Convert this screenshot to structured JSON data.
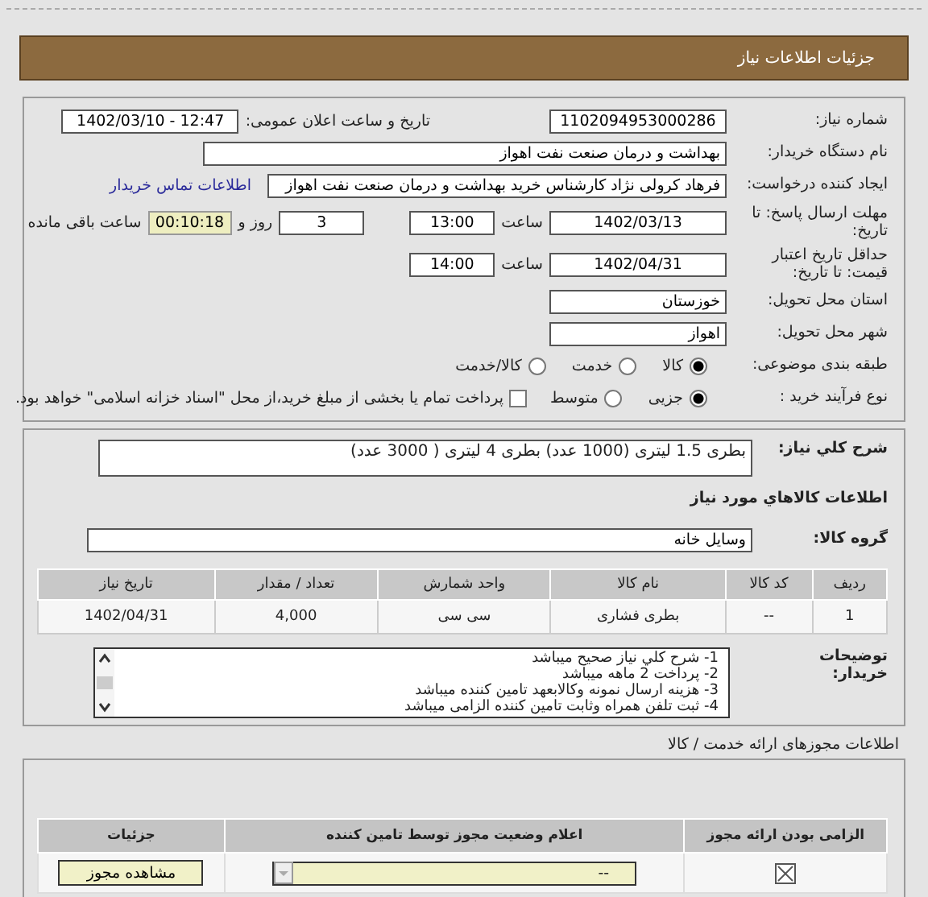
{
  "header": {
    "title": "جزئیات اطلاعات نیاز"
  },
  "details": {
    "need_number": {
      "label": "شماره نیاز:",
      "value": "1102094953000286"
    },
    "announce": {
      "label": "تاریخ و ساعت اعلان عمومی:",
      "value": "1402/03/10 - 12:47"
    },
    "buyer": {
      "label": "نام دستگاه خریدار:",
      "value": "بهداشت و درمان صنعت نفت اهواز"
    },
    "requester": {
      "label": "ایجاد کننده درخواست:",
      "value": "فرهاد کرولی نژاد کارشناس خرید بهداشت و درمان صنعت نفت اهواز",
      "link": "اطلاعات تماس خریدار"
    },
    "deadline": {
      "label": "مهلت ارسال پاسخ: تا تاریخ:",
      "date": "1402/03/13",
      "time_label": "ساعت",
      "time": "13:00",
      "days": "3",
      "days_label": "روز و",
      "remaining": "00:10:18",
      "remaining_label": "ساعت باقی مانده"
    },
    "validity": {
      "label": "حداقل تاریخ اعتبار قیمت: تا تاریخ:",
      "date": "1402/04/31",
      "time_label": "ساعت",
      "time": "14:00"
    },
    "province": {
      "label": "استان محل تحویل:",
      "value": "خوزستان"
    },
    "city": {
      "label": "شهر محل تحویل:",
      "value": "اهواز"
    },
    "category": {
      "label": "طبقه بندی موضوعی:",
      "options": [
        {
          "label": "کالا",
          "selected": true
        },
        {
          "label": "خدمت",
          "selected": false
        },
        {
          "label": "کالا/خدمت",
          "selected": false
        }
      ]
    },
    "process": {
      "label": "نوع فرآیند خرید :",
      "options": [
        {
          "label": "جزیی",
          "selected": true
        },
        {
          "label": "متوسط",
          "selected": false
        }
      ],
      "treasury": {
        "label": "پرداخت تمام یا بخشی از مبلغ خرید،از محل \"اسناد خزانه اسلامی\" خواهد بود.",
        "checked": false
      }
    }
  },
  "needs": {
    "description": {
      "label": "شرح کلي نياز:",
      "value": "بطری 1.5 لیتری (1000 عدد) بطری 4 لیتری ( 3000 عدد)"
    },
    "goods_heading": "اطلاعات کالاهاي مورد نياز",
    "group": {
      "label": "گروه کالا:",
      "value": "وسايل خانه"
    },
    "table": {
      "columns": [
        "رديف",
        "کد کالا",
        "نام کالا",
        "واحد شمارش",
        "تعداد / مقدار",
        "تاريخ نياز"
      ],
      "rows": [
        [
          "1",
          "--",
          "بطری فشاری",
          "سی سی",
          "4,000",
          "1402/04/31"
        ]
      ]
    },
    "notes": {
      "label": "توضيحات خريدار:",
      "lines": [
        "1- شرح کلي نياز صحيح ميباشد",
        "2- پرداخت 2 ماهه ميباشد",
        "3- هزينه ارسال نمونه وکالابعهد تامين کننده ميباشد",
        "4- ثبت تلفن همراه وثابت تامين کننده الزامی ميباشد"
      ]
    }
  },
  "licenses": {
    "title": "اطلاعات مجوزهای ارائه خدمت / کالا",
    "columns": [
      "الزامی بودن ارائه مجوز",
      "اعلام وضعیت مجوز توسط تامین کننده",
      "جزئیات"
    ],
    "rows": [
      {
        "required": true,
        "status": "--",
        "button": "مشاهده مجوز"
      }
    ]
  }
}
